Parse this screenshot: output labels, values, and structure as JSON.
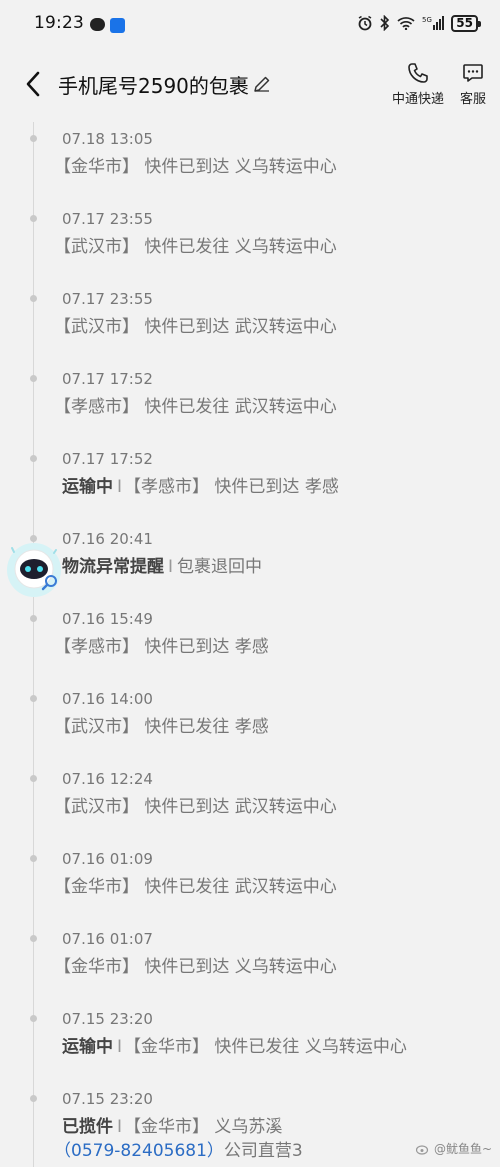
{
  "status_bar": {
    "time": "19:23",
    "battery": "55",
    "network": "5G"
  },
  "header": {
    "title": "手机尾号2590的包裹",
    "courier_label": "中通快递",
    "service_label": "客服"
  },
  "timeline": {
    "events": [
      {
        "time": "07.18 13:05",
        "status": "",
        "text": "【金华市】 快件已到达 义乌转运中心"
      },
      {
        "time": "07.17 23:55",
        "status": "",
        "text": "【武汉市】 快件已发往 义乌转运中心"
      },
      {
        "time": "07.17 23:55",
        "status": "",
        "text": "【武汉市】 快件已到达 武汉转运中心"
      },
      {
        "time": "07.17 17:52",
        "status": "",
        "text": "【孝感市】 快件已发往 武汉转运中心"
      },
      {
        "time": "07.17 17:52",
        "status": "运输中",
        "text": "【孝感市】 快件已到达 孝感"
      },
      {
        "time": "07.16 20:41",
        "status": "物流异常提醒",
        "text": "包裹退回中"
      },
      {
        "time": "07.16 15:49",
        "status": "",
        "text": "【孝感市】 快件已到达 孝感"
      },
      {
        "time": "07.16 14:00",
        "status": "",
        "text": "【武汉市】 快件已发往 孝感"
      },
      {
        "time": "07.16 12:24",
        "status": "",
        "text": "【武汉市】 快件已到达 武汉转运中心"
      },
      {
        "time": "07.16 01:09",
        "status": "",
        "text": "【金华市】 快件已发往 武汉转运中心"
      },
      {
        "time": "07.16 01:07",
        "status": "",
        "text": "【金华市】 快件已到达 义乌转运中心"
      },
      {
        "time": "07.15 23:20",
        "status": "运输中",
        "text": "【金华市】 快件已发往 义乌转运中心"
      },
      {
        "time": "07.15 23:20",
        "status": "已揽件",
        "text": "【金华市】 义乌苏溪",
        "phone": "（0579-82405681）",
        "extra": "公司直营3"
      }
    ]
  },
  "watermark": "@鱿鱼鱼~"
}
